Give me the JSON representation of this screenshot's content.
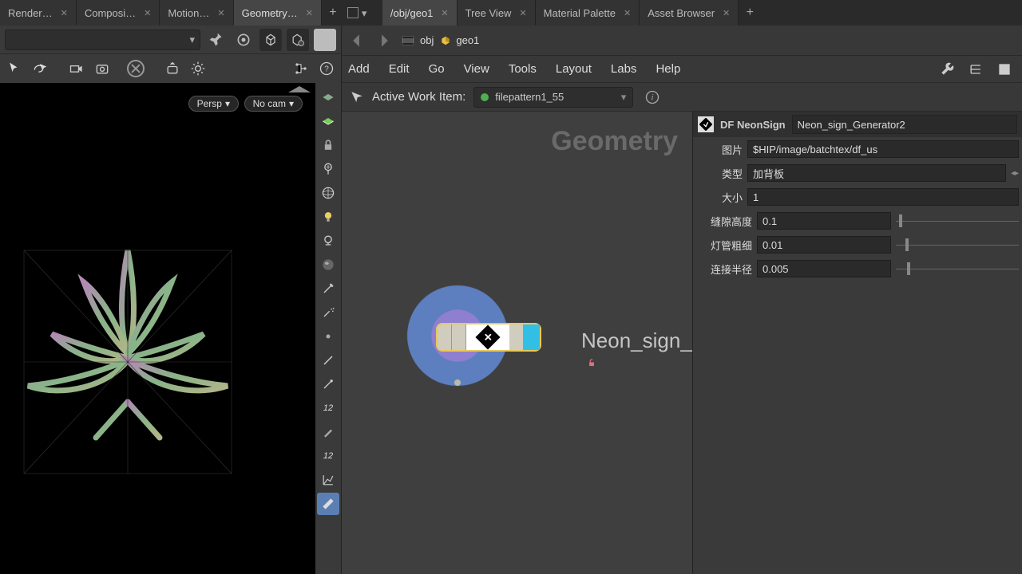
{
  "tabs_left": [
    {
      "label": "Render…"
    },
    {
      "label": "Composi…"
    },
    {
      "label": "Motion…"
    },
    {
      "label": "Geometry…",
      "active": true
    }
  ],
  "tabs_right": [
    {
      "label": "/obj/geo1",
      "active": true
    },
    {
      "label": "Tree View"
    },
    {
      "label": "Material Palette"
    },
    {
      "label": "Asset Browser"
    }
  ],
  "viewport": {
    "persp": "Persp",
    "nocam": "No cam"
  },
  "path": {
    "obj": "obj",
    "geo": "geo1"
  },
  "menu": [
    "Add",
    "Edit",
    "Go",
    "View",
    "Tools",
    "Layout",
    "Labs",
    "Help"
  ],
  "workitem": {
    "label": "Active Work Item:",
    "value": "filepattern1_55"
  },
  "graph": {
    "title": "Geometry",
    "node_label": "Neon_sign_Genera"
  },
  "params": {
    "type": "DF NeonSign",
    "name": "Neon_sign_Generator2",
    "rows": [
      {
        "label": "图片",
        "kind": "text",
        "value": "$HIP/image/batchtex/df_us"
      },
      {
        "label": "类型",
        "kind": "select",
        "value": "加背板"
      },
      {
        "label": "大小",
        "kind": "num",
        "value": "1"
      },
      {
        "label": "缝隙高度",
        "kind": "numslide",
        "value": "0.1",
        "thumb": 4
      },
      {
        "label": "灯管粗细",
        "kind": "numslide",
        "value": "0.01",
        "thumb": 12
      },
      {
        "label": "连接半径",
        "kind": "numslide",
        "value": "0.005",
        "thumb": 14
      }
    ]
  }
}
